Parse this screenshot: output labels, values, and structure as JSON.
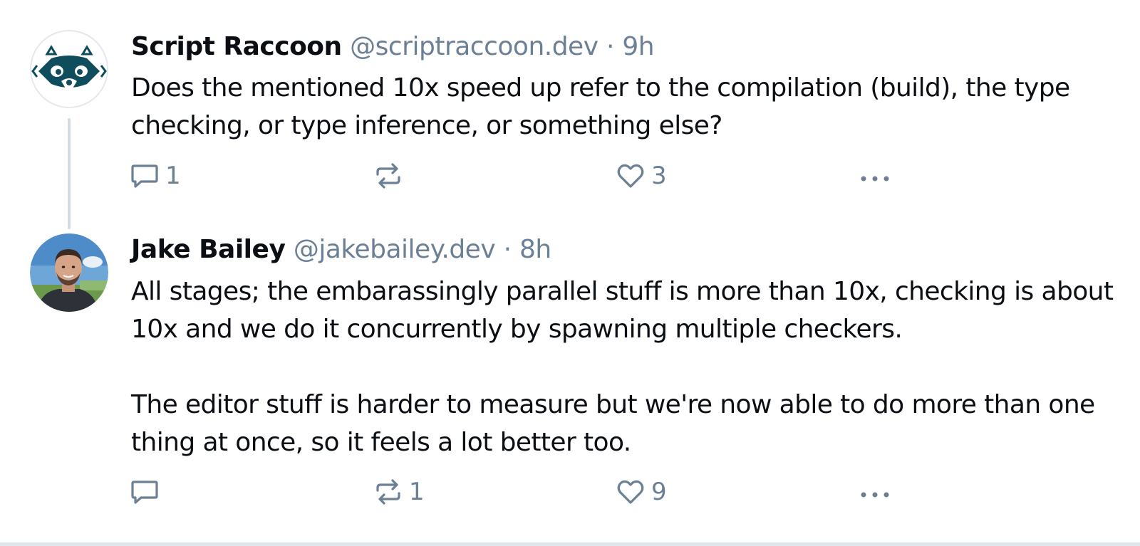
{
  "colors": {
    "text": "#0b0f14",
    "muted": "#6b7f95",
    "thread_line": "#d4dbe2",
    "raccoon_teal": "#0f4c5c"
  },
  "posts": [
    {
      "author": {
        "display_name": "Script Raccoon",
        "handle": "@scriptraccoon.dev",
        "avatar": "raccoon-logo"
      },
      "separator": "·",
      "time": "9h",
      "text": [
        "Does the mentioned 10x speed up refer to the compilation (build), the type checking, or type inference, or something else?"
      ],
      "actions": {
        "reply_count": "1",
        "repost_count": "",
        "like_count": "3"
      }
    },
    {
      "author": {
        "display_name": "Jake Bailey",
        "handle": "@jakebailey.dev",
        "avatar": "profile-photo"
      },
      "separator": "·",
      "time": "8h",
      "text": [
        "All stages; the embarassingly parallel stuff is more than 10x, checking is about 10x and we do it concurrently by spawning multiple checkers.",
        "The editor stuff is harder to measure but we're now able to do more than one thing at once, so it feels a lot better too."
      ],
      "actions": {
        "reply_count": "",
        "repost_count": "1",
        "like_count": "9"
      }
    }
  ],
  "icons": {
    "reply": "speech-bubble-icon",
    "repost": "repost-arrows-icon",
    "like": "heart-icon",
    "more": "ellipsis-icon"
  }
}
